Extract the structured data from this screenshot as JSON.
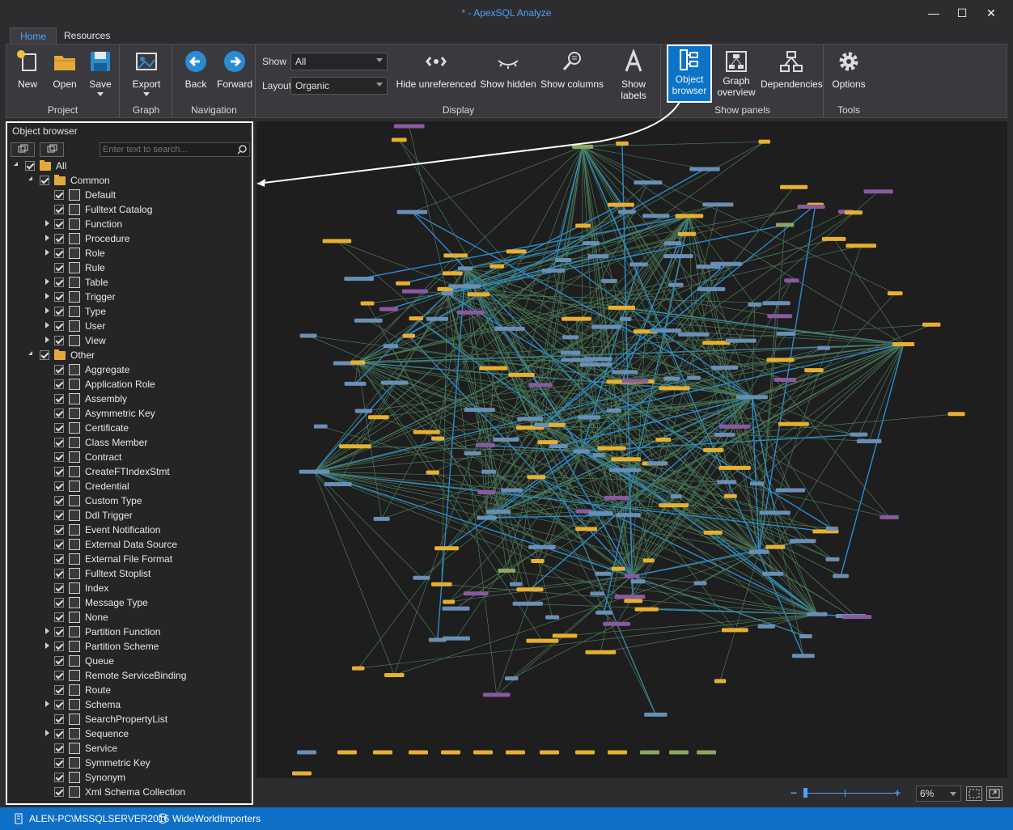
{
  "window": {
    "title": "* - ApexSQL Analyze",
    "minimize": "—",
    "maximize": "☐",
    "close": "✕"
  },
  "tabs": [
    {
      "label": "Home"
    },
    {
      "label": "Resources"
    }
  ],
  "ribbon": {
    "project": {
      "label": "Project",
      "new": "New",
      "open": "Open",
      "save": "Save"
    },
    "graph": {
      "label": "Graph",
      "export": "Export"
    },
    "navigation": {
      "label": "Navigation",
      "back": "Back",
      "forward": "Forward"
    },
    "display": {
      "label": "Display",
      "show_label": "Show",
      "show_value": "All",
      "layout_label": "Layout",
      "layout_value": "Organic",
      "hide_unreferenced": "Hide unreferenced",
      "show_hidden": "Show hidden",
      "show_columns": "Show columns",
      "show_labels": "Show labels"
    },
    "panels": {
      "label": "Show panels",
      "object_browser_1": "Object",
      "object_browser_2": "browser",
      "graph_overview_1": "Graph",
      "graph_overview_2": "overview",
      "dependencies": "Dependencies"
    },
    "tools": {
      "label": "Tools",
      "options": "Options"
    }
  },
  "object_browser": {
    "title": "Object browser",
    "search_placeholder": "Enter text to search...",
    "tree": [
      {
        "label": "All",
        "level": 0,
        "expander": "open",
        "type": "folder"
      },
      {
        "label": "Common",
        "level": 1,
        "expander": "open",
        "type": "folder"
      },
      {
        "label": "Default",
        "level": 2,
        "expander": "none",
        "type": "obj"
      },
      {
        "label": "Fulltext Catalog",
        "level": 2,
        "expander": "none",
        "type": "obj"
      },
      {
        "label": "Function",
        "level": 2,
        "expander": "closed",
        "type": "obj"
      },
      {
        "label": "Procedure",
        "level": 2,
        "expander": "closed",
        "type": "obj"
      },
      {
        "label": "Role",
        "level": 2,
        "expander": "closed",
        "type": "obj"
      },
      {
        "label": "Rule",
        "level": 2,
        "expander": "none",
        "type": "obj"
      },
      {
        "label": "Table",
        "level": 2,
        "expander": "closed",
        "type": "obj"
      },
      {
        "label": "Trigger",
        "level": 2,
        "expander": "closed",
        "type": "obj"
      },
      {
        "label": "Type",
        "level": 2,
        "expander": "closed",
        "type": "obj"
      },
      {
        "label": "User",
        "level": 2,
        "expander": "closed",
        "type": "obj"
      },
      {
        "label": "View",
        "level": 2,
        "expander": "closed",
        "type": "obj"
      },
      {
        "label": "Other",
        "level": 1,
        "expander": "open",
        "type": "folder"
      },
      {
        "label": "Aggregate",
        "level": 2,
        "expander": "none",
        "type": "obj"
      },
      {
        "label": "Application Role",
        "level": 2,
        "expander": "none",
        "type": "obj"
      },
      {
        "label": "Assembly",
        "level": 2,
        "expander": "none",
        "type": "obj"
      },
      {
        "label": "Asymmetric Key",
        "level": 2,
        "expander": "none",
        "type": "obj"
      },
      {
        "label": "Certificate",
        "level": 2,
        "expander": "none",
        "type": "obj"
      },
      {
        "label": "Class Member",
        "level": 2,
        "expander": "none",
        "type": "obj"
      },
      {
        "label": "Contract",
        "level": 2,
        "expander": "none",
        "type": "obj"
      },
      {
        "label": "CreateFTIndexStmt",
        "level": 2,
        "expander": "none",
        "type": "obj"
      },
      {
        "label": "Credential",
        "level": 2,
        "expander": "none",
        "type": "obj"
      },
      {
        "label": "Custom Type",
        "level": 2,
        "expander": "none",
        "type": "obj"
      },
      {
        "label": "Ddl Trigger",
        "level": 2,
        "expander": "none",
        "type": "obj"
      },
      {
        "label": "Event Notification",
        "level": 2,
        "expander": "none",
        "type": "obj"
      },
      {
        "label": "External Data Source",
        "level": 2,
        "expander": "none",
        "type": "obj"
      },
      {
        "label": "External File Format",
        "level": 2,
        "expander": "none",
        "type": "obj"
      },
      {
        "label": "Fulltext Stoplist",
        "level": 2,
        "expander": "none",
        "type": "obj"
      },
      {
        "label": "Index",
        "level": 2,
        "expander": "none",
        "type": "obj"
      },
      {
        "label": "Message Type",
        "level": 2,
        "expander": "none",
        "type": "obj"
      },
      {
        "label": "None",
        "level": 2,
        "expander": "none",
        "type": "obj"
      },
      {
        "label": "Partition Function",
        "level": 2,
        "expander": "closed",
        "type": "obj"
      },
      {
        "label": "Partition Scheme",
        "level": 2,
        "expander": "closed",
        "type": "obj"
      },
      {
        "label": "Queue",
        "level": 2,
        "expander": "none",
        "type": "obj"
      },
      {
        "label": "Remote ServiceBinding",
        "level": 2,
        "expander": "none",
        "type": "obj"
      },
      {
        "label": "Route",
        "level": 2,
        "expander": "none",
        "type": "obj"
      },
      {
        "label": "Schema",
        "level": 2,
        "expander": "closed",
        "type": "obj"
      },
      {
        "label": "SearchPropertyList",
        "level": 2,
        "expander": "none",
        "type": "obj"
      },
      {
        "label": "Sequence",
        "level": 2,
        "expander": "closed",
        "type": "obj"
      },
      {
        "label": "Service",
        "level": 2,
        "expander": "none",
        "type": "obj"
      },
      {
        "label": "Symmetric Key",
        "level": 2,
        "expander": "none",
        "type": "obj"
      },
      {
        "label": "Synonym",
        "level": 2,
        "expander": "none",
        "type": "obj"
      },
      {
        "label": "Xml Schema Collection",
        "level": 2,
        "expander": "none",
        "type": "obj"
      }
    ]
  },
  "zoom": {
    "minus": "−",
    "plus": "+",
    "value": "6%"
  },
  "status": {
    "server": "ALEN-PC\\MSSQLSERVER2016",
    "database": "WideWorldImporters"
  },
  "colors": {
    "accent": "#0e6fc7",
    "node_blue": "#6a8fb5",
    "node_orange": "#e8b030",
    "node_purple": "#8a5aa0",
    "node_green": "#8aa860",
    "edge_green": "#4a7a5a",
    "edge_blue": "#2a8cd0"
  }
}
